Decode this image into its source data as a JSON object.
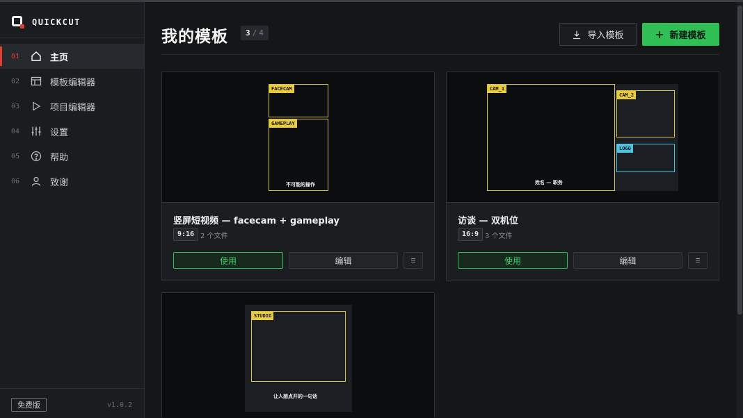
{
  "app": {
    "name": "QUICKCUT",
    "version": "v1.0.2",
    "plan": "免费版"
  },
  "nav": [
    {
      "num": "01",
      "label": "主页",
      "icon": "home-icon",
      "active": true
    },
    {
      "num": "02",
      "label": "模板编辑器",
      "icon": "layout-icon",
      "active": false
    },
    {
      "num": "03",
      "label": "项目编辑器",
      "icon": "play-icon",
      "active": false
    },
    {
      "num": "04",
      "label": "设置",
      "icon": "sliders-icon",
      "active": false
    },
    {
      "num": "05",
      "label": "帮助",
      "icon": "help-circle-icon",
      "active": false
    },
    {
      "num": "06",
      "label": "致谢",
      "icon": "user-icon",
      "active": false
    }
  ],
  "header": {
    "title": "我的模板",
    "count_current": "3",
    "count_sep": "/",
    "count_total": "4",
    "import_label": "导入模板",
    "new_label": "新建模板"
  },
  "colors": {
    "accent_red": "#e23b2f",
    "accent_green": "#2fbf55",
    "slot_yellow": "#e8cc3e",
    "slot_cyan": "#4fc3e0"
  },
  "cards": [
    {
      "title": "竖屏短视频 — facecam + gameplay",
      "ratio": "9:16",
      "files": "2 个文件",
      "use_label": "使用",
      "edit_label": "编辑",
      "slots": [
        "FACECAM",
        "GAMEPLAY"
      ],
      "caption": "不可能的操作"
    },
    {
      "title": "访谈 — 双机位",
      "ratio": "16:9",
      "files": "3 个文件",
      "use_label": "使用",
      "edit_label": "编辑",
      "slots": [
        "CAM_1",
        "CAM_2",
        "LOGO"
      ],
      "caption": "姓名 — 职务"
    },
    {
      "slots": [
        "STUDIO"
      ],
      "caption": "让人想点开的一句话"
    }
  ]
}
